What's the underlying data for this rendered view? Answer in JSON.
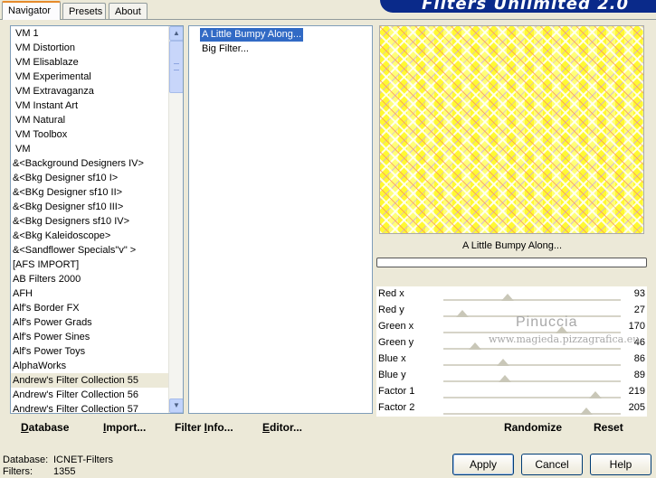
{
  "tabs": [
    "Navigator",
    "Presets",
    "About"
  ],
  "banner": {
    "title": "Filters Unlimited 2.0"
  },
  "categories": [
    "VM 1",
    "VM Distortion",
    "VM Elisablaze",
    "VM Experimental",
    "VM Extravaganza",
    "VM Instant Art",
    "VM Natural",
    "VM Toolbox",
    "VM",
    "&<Background Designers IV>",
    "&<Bkg Designer sf10 I>",
    "&<BKg Designer sf10 II>",
    "&<Bkg Designer sf10 III>",
    "&<Bkg Designers sf10 IV>",
    "&<Bkg Kaleidoscope>",
    "&<Sandflower Specials\"v\" >",
    "[AFS IMPORT]",
    "AB Filters 2000",
    "AFH",
    "Alf's Border FX",
    "Alf's Power Grads",
    "Alf's Power Sines",
    "Alf's Power Toys",
    "AlphaWorks",
    "Andrew's Filter Collection 55",
    "Andrew's Filter Collection 56",
    "Andrew's Filter Collection 57"
  ],
  "selected_category_index": 24,
  "filters": [
    "A Little Bumpy Along...",
    "Big Filter..."
  ],
  "selected_filter_index": 0,
  "preview_filter_name": "A Little Bumpy Along...",
  "progress": 0,
  "sliders": [
    {
      "label": "Red x",
      "value": 93
    },
    {
      "label": "Red y",
      "value": 27
    },
    {
      "label": "Green x",
      "value": 170
    },
    {
      "label": "Green y",
      "value": 46
    },
    {
      "label": "Blue x",
      "value": 86
    },
    {
      "label": "Blue y",
      "value": 89
    },
    {
      "label": "Factor 1",
      "value": 219
    },
    {
      "label": "Factor 2",
      "value": 205
    }
  ],
  "watermark": {
    "line1": "Pinuccia",
    "line2": "www.magieda.pizzagrafica.eu"
  },
  "left_buttons": {
    "database": {
      "u": "D",
      "rest": "atabase"
    },
    "import": {
      "u": "I",
      "rest": "mport..."
    },
    "filter_info": {
      "pre": "Filter ",
      "u": "I",
      "rest": "nfo..."
    },
    "editor": {
      "u": "E",
      "rest": "ditor..."
    }
  },
  "right_buttons": {
    "randomize": "Randomize",
    "reset": "Reset"
  },
  "status": {
    "database_label": "Database:",
    "database_value": "ICNET-Filters",
    "filters_label": "Filters:",
    "filters_value": "1355"
  },
  "dialog_buttons": {
    "apply": "Apply",
    "cancel": "Cancel",
    "help": "Help"
  },
  "colors": {
    "accent_tab": "#e68b2c",
    "selection": "#316ac5",
    "dialog_bg": "#ece9d8"
  }
}
